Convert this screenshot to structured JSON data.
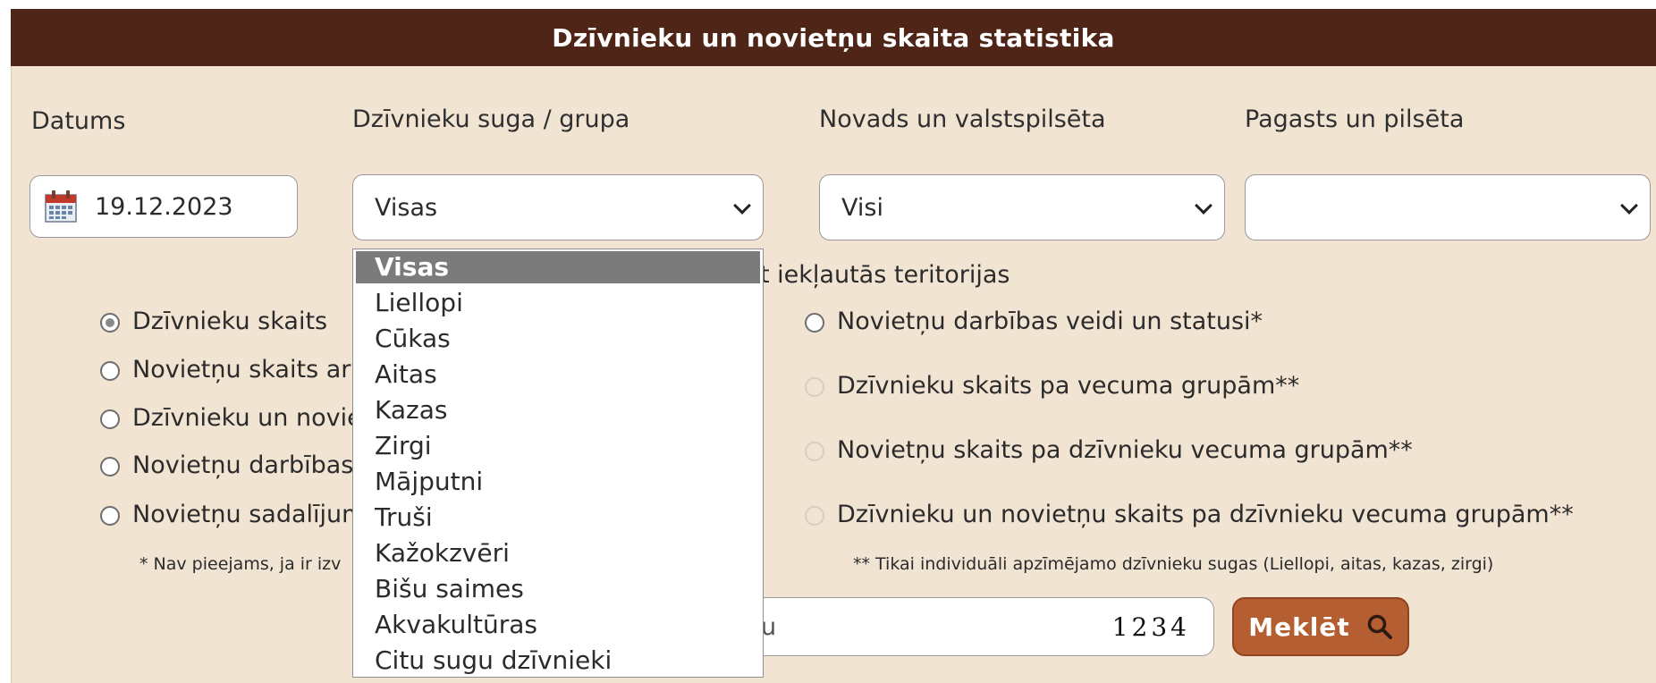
{
  "header": {
    "title": "Dzīvnieku un novietņu skaita statistika"
  },
  "filters": {
    "date_label": "Datums",
    "date_value": "19.12.2023",
    "species_label": "Dzīvnieku suga / grupa",
    "species_value": "Visas",
    "county_label": "Novads un valstspilsēta",
    "county_value": "Visi",
    "parish_label": "Pagasts un pilsēta",
    "parish_value": ""
  },
  "territory_text": "t iekļautās teritorijas",
  "report_left": [
    {
      "label": "Dzīvnieku skaits",
      "checked": true
    },
    {
      "label": "Novietņu skaits ar",
      "checked": false
    },
    {
      "label": "Dzīvnieku un novie",
      "checked": false
    },
    {
      "label": "Novietņu darbības",
      "checked": false
    },
    {
      "label": "Novietņu sadalījum",
      "checked": false
    }
  ],
  "report_right": [
    {
      "label": "Novietņu darbības veidi un statusi*",
      "disabled": false
    },
    {
      "label": "Dzīvnieku skaits pa vecuma grupām**",
      "disabled": true
    },
    {
      "label": "Novietņu skaits pa dzīvnieku vecuma grupām**",
      "disabled": true
    },
    {
      "label": "Dzīvnieku un novietņu skaits pa dzīvnieku vecuma grupām**",
      "disabled": true
    }
  ],
  "notes": {
    "left": "* Nav pieejams, ja ir izv",
    "right": "** Tikai individuāli apzīmējamo dzīvnieku sugas (Liellopi, aitas, kazas, zirgi)"
  },
  "captcha": {
    "input_text": "u",
    "digits": "1234"
  },
  "search_button": {
    "label": "Meklēt",
    "icon": "search-icon"
  },
  "dropdown_options": [
    "Visas",
    "Liellopi",
    "Cūkas",
    "Aitas",
    "Kazas",
    "Zirgi",
    "Mājputni",
    "Truši",
    "Kažokzvēri",
    "Bišu saimes",
    "Akvakultūras",
    "Citu sugu dzīvnieki"
  ],
  "colors": {
    "header_bg": "#4e2516",
    "panel_bg": "#f2e4d3",
    "button_bg": "#b55e31",
    "selected_option": "#7b7b7b"
  }
}
